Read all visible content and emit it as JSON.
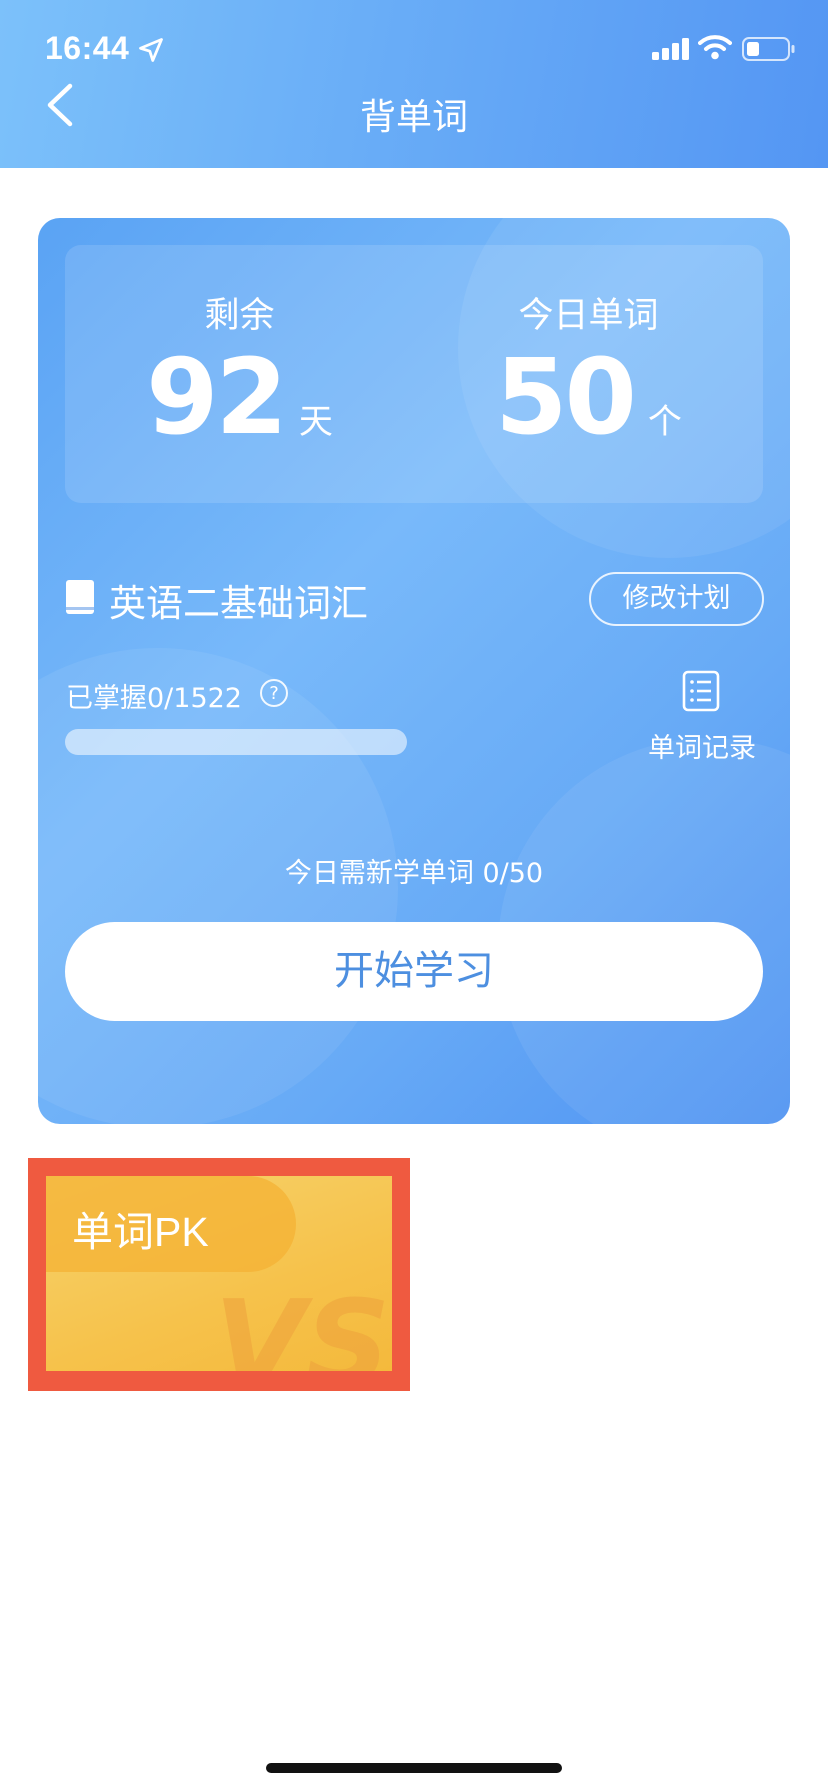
{
  "status_bar": {
    "time": "16:44"
  },
  "header": {
    "title": "背单词"
  },
  "plan_card": {
    "remaining_label": "剩余",
    "remaining_value": "92",
    "remaining_unit": "天",
    "today_label": "今日单词",
    "today_value": "50",
    "today_unit": "个",
    "book_name": "英语二基础词汇",
    "modify_label": "修改计划",
    "mastered_text": "已掌握0/1522",
    "mastered_progress": 0,
    "record_label": "单词记录",
    "today_need_text": "今日需新学单词 0/50",
    "start_label": "开始学习"
  },
  "pk_card": {
    "label": "单词PK",
    "vs_text": "VS"
  },
  "colors": {
    "header_start": "#7cc1fa",
    "header_end": "#5496f3",
    "card_blue": "#67aaf6",
    "start_text": "#4d8fe0",
    "pk_yellow": "#f6c24b",
    "highlight": "#ef5a40"
  }
}
